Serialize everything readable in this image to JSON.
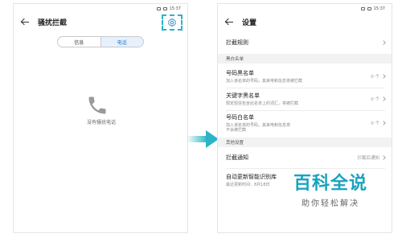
{
  "left_screen": {
    "status_time": "15:37",
    "title": "骚扰拦截",
    "tabs": [
      {
        "label": "信息",
        "active": false
      },
      {
        "label": "电话",
        "active": true
      }
    ],
    "empty_text": "没有骚扰电话",
    "icons": {
      "back": "arrow-left-icon",
      "settings": "gear-icon",
      "empty": "phone-handset-icon"
    }
  },
  "right_screen": {
    "status_time": "15:37",
    "title": "设置",
    "rule_row": {
      "label": "拦截规则"
    },
    "blacklist_section": "黑白名单",
    "rows": [
      {
        "title": "号码黑名单",
        "subtitle": "加入该名单的号码，其来电和信息将被拦截",
        "value": "0 个"
      },
      {
        "title": "关键字黑名单",
        "subtitle": "限定短信包含此名单上的词汇，将被拦截",
        "value": "0 个"
      },
      {
        "title": "号码白名单",
        "subtitle": "加入该名单的号码，其来电和信息将\n不会被拦截",
        "value": "0 个"
      }
    ],
    "other_section": "其他设置",
    "notify_row": {
      "label": "拦截通知",
      "value": "拦截后通知"
    },
    "update_row": {
      "title": "自动更新智能识别库",
      "subtitle": "最近更新时间：8月18日"
    }
  },
  "watermark": {
    "big": "百科全说",
    "small": "助你轻松解决"
  },
  "colors": {
    "accent": "#2bb4c6",
    "tab_active": "#1a73d9",
    "watermark": "#19a2c0"
  }
}
